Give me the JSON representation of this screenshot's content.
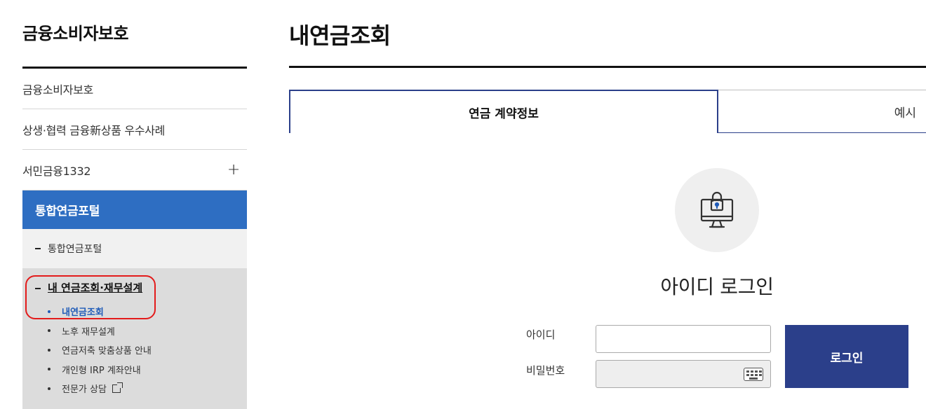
{
  "sidebar": {
    "title": "금융소비자보호",
    "items": [
      {
        "label": "금융소비자보호"
      },
      {
        "label": "상생·협력 금융新상품 우수사례"
      },
      {
        "label": "서민금융1332",
        "expand": "+"
      }
    ],
    "active_section": "통합연금포털",
    "sub_item": "통합연금포털",
    "sub_group": {
      "heading": "내 연금조회·재무설계",
      "links": [
        {
          "label": "내연금조회",
          "current": true
        },
        {
          "label": "노후 재무설계"
        },
        {
          "label": "연금저축 맞춤상품 안내"
        },
        {
          "label": "개인형 IRP 계좌안내"
        },
        {
          "label": "전문가 상담",
          "external": true
        }
      ]
    }
  },
  "main": {
    "title": "내연금조회",
    "tabs": [
      {
        "label": "연금 계약정보",
        "active": true
      },
      {
        "label": "예시",
        "active": false
      }
    ],
    "login": {
      "icon": "computer-lock-icon",
      "heading": "아이디 로그인",
      "id_label": "아이디",
      "id_value": "",
      "pw_label": "비밀번호",
      "pw_value": "",
      "button_label": "로그인"
    }
  },
  "colors": {
    "accent_blue": "#2e6ec2",
    "navy": "#2b3f8a",
    "highlight_red": "#e31b1b",
    "current_link": "#1f5bb8"
  }
}
